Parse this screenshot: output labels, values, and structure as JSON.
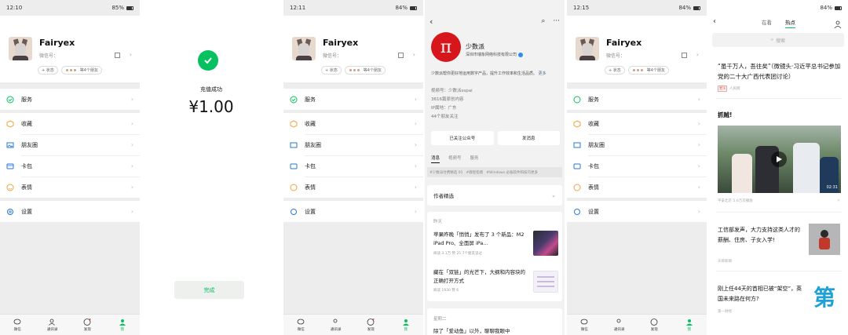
{
  "screens": {
    "me": {
      "name": "Fairyex",
      "wechat_id_label": "微信号：",
      "status_chip": "+ 状态",
      "friends_chip": "等4个朋友",
      "menu": [
        {
          "label": "服务"
        },
        {
          "label": "收藏"
        },
        {
          "label": "朋友圈"
        },
        {
          "label": "卡包"
        },
        {
          "label": "表情"
        },
        {
          "label": "设置"
        }
      ],
      "tabs": [
        "微信",
        "通讯录",
        "发现",
        "我"
      ]
    },
    "payment": {
      "title": "充值成功",
      "amount": "¥1.00",
      "done": "完成"
    },
    "official_account": {
      "logo": "π",
      "name": "少数派",
      "company": "深圳市瑞象网络科技有限公司",
      "desc": "少数派帮你更好地运用数字产品，提升工作效率和生活品质。",
      "more": "更多",
      "wechat_id": "视频号：少数派sspai",
      "count": "3616篇原创内容",
      "ip_region": "IP属地：广东",
      "friends": "44个朋友关注",
      "btn_followed": "已关注公众号",
      "btn_message": "发消息",
      "tabs": [
        "消息",
        "视频号",
        "服务"
      ],
      "tags": [
        "#少数派付费精选 01",
        "#教程指南",
        "#Windows 必备软件和技巧更多"
      ],
      "author_picks": "作者精选",
      "date1": "昨天",
      "article1_title": "苹果昨晚「悄悄」发布了 3 个新品：M2 iPad Pro、全面屏 iPa…",
      "article1_meta": "阅读 3.1万  赞 25  7个朋友读过",
      "article2_title": "藏在「双链」的光芒下，大纲和内容块的正确打开方式",
      "article2_meta": "阅读 1930  赞 6",
      "date2": "星期二",
      "article3_title": "除了「爱动鱼」以外，聊聊我眼中"
    },
    "news": {
      "tabs": [
        "在看",
        "热点"
      ],
      "search_placeholder": "搜索",
      "headline": "“虽千万人，吾往矣”（微镜头·习近平总书记参加党的二十大广西代表团讨论）",
      "headline_source": "人民网",
      "headline_tag": "置顶",
      "section": "抓贼!",
      "video_duration": "02:31",
      "video_source": "平安北京  5.6万次播放",
      "item1_title": "工信部发声，大力支持这类人才的薪酬、住房、子女入学!",
      "item1_source": "天目新闻",
      "item2_title": "刚上任44天的首相已被“架空”，英国未来路在何方?",
      "item2_source": "第一财经",
      "item2_thumb": "第"
    }
  },
  "status": {
    "time1": "12:10",
    "time3": "12:11",
    "time5": "12:15",
    "battery1": "85%",
    "battery3": "84%",
    "battery5": "84%",
    "battery6": "84%"
  },
  "colors": {
    "accent": "#07c160",
    "oa_logo": "#d7161b"
  }
}
